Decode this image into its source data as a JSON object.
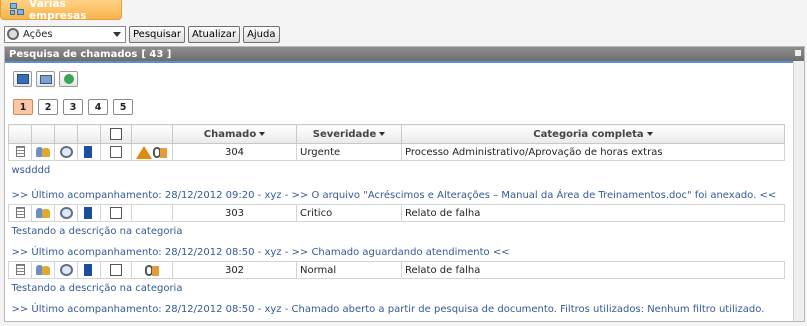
{
  "company_tab": {
    "label": "Várias empresas",
    "icon": "companies-icon"
  },
  "toolbar": {
    "actions_value": "Ações",
    "search_label": "Pesquisar",
    "refresh_label": "Atualizar",
    "help_label": "Ajuda"
  },
  "panel": {
    "title": "Pesquisa de chamados",
    "count": "[ 43 ]"
  },
  "pager": {
    "pages": [
      "1",
      "2",
      "3",
      "4",
      "5"
    ],
    "current": "1"
  },
  "table": {
    "headers": {
      "chamado": "Chamado",
      "severidade": "Severidade",
      "categoria": "Categoria completa"
    },
    "rows": [
      {
        "chamado": "304",
        "severidade": "Urgente",
        "categoria": "Processo Administrativo/Aprovação de horas extras",
        "descricao": "wsdddd",
        "acompanhamento": ">>  Último acompanhamento: 28/12/2012 09:20 - xyz - >> O arquivo \"Acréscimos e Alterações – Manual da Área de Treinamentos.doc\" foi anexado. <<",
        "status_icons": [
          "warning-icon",
          "attachment-icon"
        ]
      },
      {
        "chamado": "303",
        "severidade": "Critico",
        "categoria": "Relato de falha",
        "descricao": "Testando a descrição na categoria",
        "acompanhamento": ">>  Último acompanhamento: 28/12/2012 08:50 - xyz - >> Chamado aguardando atendimento <<",
        "status_icons": []
      },
      {
        "chamado": "302",
        "severidade": "Normal",
        "categoria": "Relato de falha",
        "descricao": "Testando a descrição na categoria",
        "acompanhamento": ">>  Último acompanhamento: 28/12/2012 08:50 - xyz - Chamado aberto a partir de pesquisa de documento. Filtros utilizados: Nenhum filtro utilizado.",
        "status_icons": [
          "attachment-icon"
        ]
      }
    ]
  },
  "colors": {
    "accent_orange": "#f7b24a",
    "header_gray": "#7a7a7a",
    "link_blue": "#345a96",
    "active_page": "#f9c7a4"
  }
}
